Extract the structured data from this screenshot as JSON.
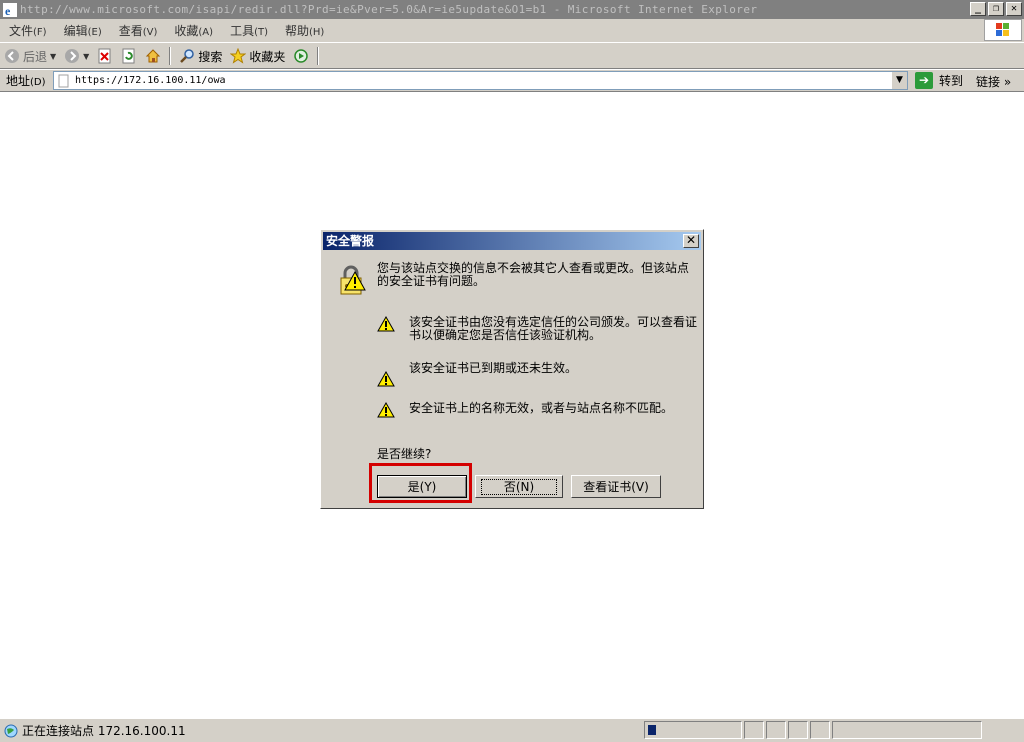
{
  "window": {
    "title": "http://www.microsoft.com/isapi/redir.dll?Prd=ie&Pver=5.0&Ar=ie5update&O1=b1 - Microsoft Internet Explorer"
  },
  "menu": {
    "items": [
      {
        "label": "文件",
        "key": "(F)"
      },
      {
        "label": "编辑",
        "key": "(E)"
      },
      {
        "label": "查看",
        "key": "(V)"
      },
      {
        "label": "收藏",
        "key": "(A)"
      },
      {
        "label": "工具",
        "key": "(T)"
      },
      {
        "label": "帮助",
        "key": "(H)"
      }
    ]
  },
  "toolbar": {
    "back": "后退",
    "search": "搜索",
    "favorites": "收藏夹"
  },
  "address": {
    "label": "地址",
    "key": "(D)",
    "value": "https://172.16.100.11/owa",
    "go": "转到",
    "links": "链接"
  },
  "dialog": {
    "title": "安全警报",
    "message": "您与该站点交换的信息不会被其它人查看或更改。但该站点的安全证书有问题。",
    "warnings": [
      "该安全证书由您没有选定信任的公司颁发。可以查看证书以便确定您是否信任该验证机构。",
      "该安全证书已到期或还未生效。",
      "安全证书上的名称无效，或者与站点名称不匹配。"
    ],
    "question": "是否继续?",
    "buttons": {
      "yes": "是(Y)",
      "no": "否(N)",
      "view_cert": "查看证书(V)"
    }
  },
  "status": {
    "text": "正在连接站点 172.16.100.11",
    "progress": 0.04
  },
  "colors": {
    "title_active": "#0a246a",
    "highlight": "#d40000"
  }
}
